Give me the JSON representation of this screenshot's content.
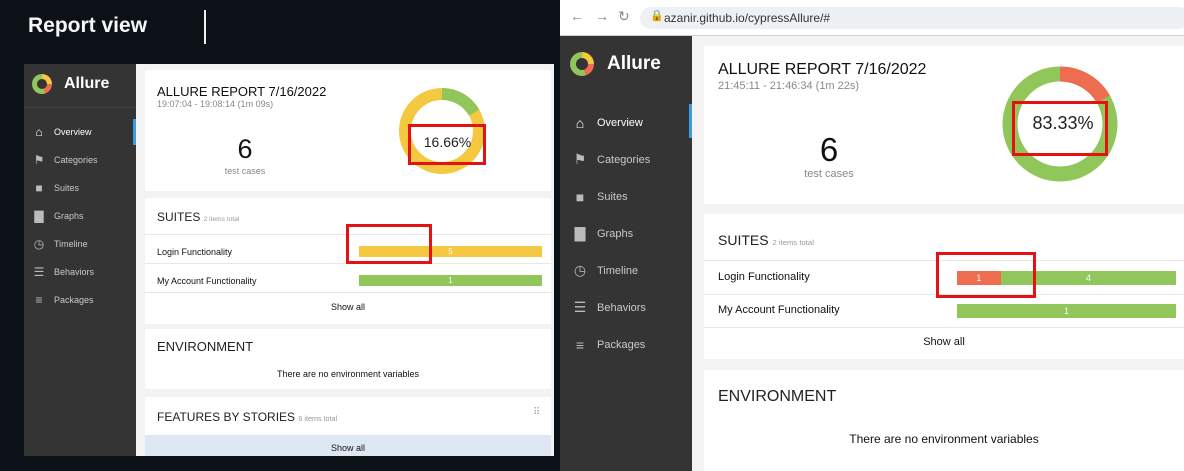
{
  "page_title": "Report view",
  "browser": {
    "url": "azanir.github.io/cypressAllure/#"
  },
  "brand": "Allure",
  "nav": [
    {
      "icon": "home-icon",
      "label": "Overview",
      "active": true
    },
    {
      "icon": "flag-icon",
      "label": "Categories",
      "active": false
    },
    {
      "icon": "briefcase-icon",
      "label": "Suites",
      "active": false
    },
    {
      "icon": "bar-chart-icon",
      "label": "Graphs",
      "active": false
    },
    {
      "icon": "clock-icon",
      "label": "Timeline",
      "active": false
    },
    {
      "icon": "list-icon",
      "label": "Behaviors",
      "active": false
    },
    {
      "icon": "align-left-icon",
      "label": "Packages",
      "active": false
    }
  ],
  "reports": [
    {
      "title": "ALLURE REPORT 7/16/2022",
      "time": "19:07:04 - 19:08:14 (1m 09s)",
      "count": "6",
      "count_label": "test cases",
      "pct": "16.66%",
      "pass_fraction": 0.1666,
      "suites_label": "SUITES",
      "suites_sub": "2 items total",
      "suites": [
        {
          "name": "Login Functionality",
          "segments": [
            {
              "value": 5,
              "label": "5",
              "color": "#f5c842"
            }
          ]
        },
        {
          "name": "My Account Functionality",
          "segments": [
            {
              "value": 1,
              "label": "1",
              "color": "#90c65a"
            }
          ]
        }
      ],
      "show_all": "Show all",
      "env_title": "ENVIRONMENT",
      "env_text": "There are no environment variables",
      "features_title": "FEATURES BY STORIES",
      "features_sub": "6 items total",
      "features_show_all": "Show all"
    },
    {
      "title": "ALLURE REPORT 7/16/2022",
      "time": "21:45:11 - 21:46:34 (1m 22s)",
      "count": "6",
      "count_label": "test cases",
      "pct": "83.33%",
      "pass_fraction": 0.8333,
      "suites_label": "SUITES",
      "suites_sub": "2 items total",
      "suites": [
        {
          "name": "Login Functionality",
          "segments": [
            {
              "value": 1,
              "label": "1",
              "color": "#ee6c4f"
            },
            {
              "value": 4,
              "label": "4",
              "color": "#90c65a"
            }
          ]
        },
        {
          "name": "My Account Functionality",
          "segments": [
            {
              "value": 1,
              "label": "1",
              "color": "#90c65a"
            }
          ]
        }
      ],
      "show_all": "Show all",
      "env_title": "ENVIRONMENT",
      "env_text": "There are no environment variables"
    }
  ],
  "colors": {
    "passed": "#90c65a",
    "failed": "#ee6c4f",
    "broken": "#f5c842",
    "sidebar": "#343434",
    "active": "#3a9de0",
    "highlight": "#e41212"
  }
}
